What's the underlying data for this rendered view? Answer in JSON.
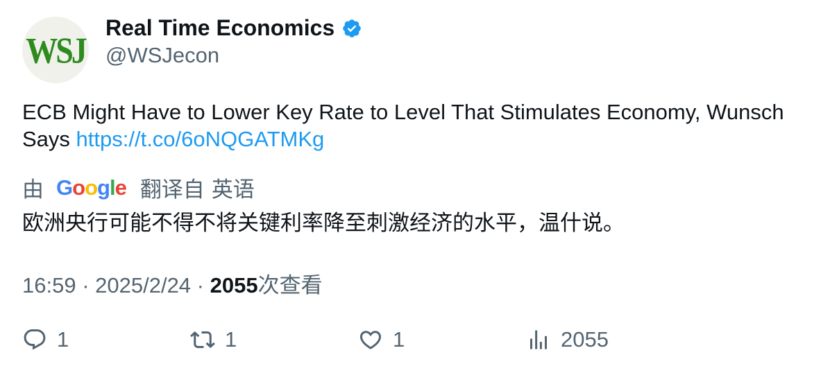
{
  "author": {
    "avatar_text": "WSJ",
    "display_name": "Real Time Economics",
    "handle": "@WSJecon",
    "verified": true
  },
  "tweet": {
    "text": "ECB Might Have to Lower Key Rate to Level That Stimulates Economy, Wunsch Says ",
    "link": "https://t.co/6oNQGATMKg"
  },
  "translation": {
    "by_label": "由",
    "provider": "Google",
    "translated_from_label": "翻译自",
    "source_language": "英语",
    "translated_text": "欧洲央行可能不得不将关键利率降至刺激经济的水平，温什说。"
  },
  "meta": {
    "time": "16:59",
    "separator": " · ",
    "date": "2025/2/24",
    "views_count": "2055",
    "views_label": "次查看"
  },
  "actions": {
    "reply_count": "1",
    "retweet_count": "1",
    "like_count": "1",
    "views_count": "2055"
  },
  "colors": {
    "text": "#0f1419",
    "secondary": "#536471",
    "link": "#1d9bf0",
    "verified": "#1d9bf0"
  }
}
